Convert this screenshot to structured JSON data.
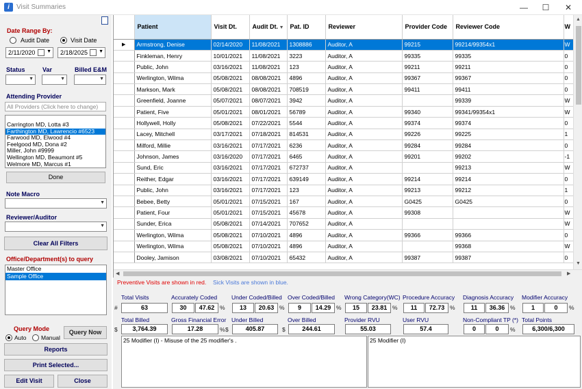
{
  "window": {
    "title": "Visit Summaries",
    "minimize": "—",
    "maximize": "☐",
    "close": "✕"
  },
  "filters": {
    "date_range_label": "Date Range By:",
    "audit_date": "Audit Date",
    "visit_date": "Visit Date",
    "date_from": "2/11/2020",
    "date_to": "2/18/2025",
    "status_label": "Status",
    "var_label": "Var",
    "billed_em_label": "Billed E&M",
    "attending_label": "Attending Provider",
    "attending_placeholder": "All Providers (Click here to change)",
    "providers": [
      "Carrington MD, Lotta #3",
      "Farthington MD, Lawrencio #6523",
      "Farwood MD, Elwood #4",
      "Feelgood MD, Dona #2",
      "Miller, John #9999",
      "Wellington MD, Beaumont #5",
      "Welmore MD, Marcus #1"
    ],
    "done": "Done",
    "note_macro_label": "Note Macro",
    "reviewer_label": "Reviewer/Auditor",
    "clear_filters": "Clear All Filters",
    "office_label": "Office/Department(s) to query",
    "offices": [
      "Master Office",
      "Sample Office"
    ],
    "query_mode_label": "Query Mode",
    "auto": "Auto",
    "manual": "Manual",
    "query_now": "Query Now",
    "reports": "Reports",
    "print_selected": "Print Selected...",
    "edit_visit": "Edit Visit",
    "close": "Close"
  },
  "grid": {
    "columns": [
      "Patient",
      "Visit Dt.",
      "Audit Dt.",
      "Pat. ID",
      "Reviewer",
      "Provider Code",
      "Reviewer Code",
      "W"
    ],
    "rows": [
      [
        "Armstrong, Denise",
        "02/14/2020",
        "11/08/2021",
        "1308886",
        "Auditor, A",
        "99215",
        "99214/99354x1",
        "W"
      ],
      [
        "Finkleman, Henry",
        "10/01/2021",
        "11/08/2021",
        "3223",
        "Auditor, A",
        "99335",
        "99335",
        "0"
      ],
      [
        "Public, John",
        "03/16/2021",
        "11/08/2021",
        "123",
        "Auditor, A",
        "99211",
        "99211",
        "0"
      ],
      [
        "Werlington, Wilma",
        "05/08/2021",
        "08/08/2021",
        "4896",
        "Auditor, A",
        "99367",
        "99367",
        "0"
      ],
      [
        "Markson, Mark",
        "05/08/2021",
        "08/08/2021",
        "708519",
        "Auditor, A",
        "99411",
        "99411",
        "0"
      ],
      [
        "Greenfield, Joanne",
        "05/07/2021",
        "08/07/2021",
        "3942",
        "Auditor, A",
        "",
        "99339",
        "W"
      ],
      [
        "Patient, Five",
        "05/01/2021",
        "08/01/2021",
        "56789",
        "Auditor, A",
        "99340",
        "99341/99354x1",
        "W"
      ],
      [
        "Hollywell, Holly",
        "05/08/2021",
        "07/22/2021",
        "5544",
        "Auditor, A",
        "99374",
        "99374",
        "0"
      ],
      [
        "Lacey, Mitchell",
        "03/17/2021",
        "07/18/2021",
        "814531",
        "Auditor, A",
        "99226",
        "99225",
        "1"
      ],
      [
        "Milford, Millie",
        "03/16/2021",
        "07/17/2021",
        "6236",
        "Auditor, A",
        "99284",
        "99284",
        "0"
      ],
      [
        "Johnson, James",
        "03/16/2020",
        "07/17/2021",
        "6465",
        "Auditor, A",
        "99201",
        "99202",
        "-1"
      ],
      [
        "Sund, Eric",
        "03/16/2021",
        "07/17/2021",
        "672737",
        "Auditor, A",
        "",
        "99213",
        "W"
      ],
      [
        "Reither, Edgar",
        "03/16/2021",
        "07/17/2021",
        "639149",
        "Auditor, A",
        "99214",
        "99214",
        "0"
      ],
      [
        "Public, John",
        "03/16/2021",
        "07/17/2021",
        "123",
        "Auditor, A",
        "99213",
        "99212",
        "1"
      ],
      [
        "Bebee, Betty",
        "05/01/2021",
        "07/15/2021",
        "167",
        "Auditor, A",
        "G0425",
        "G0425",
        "0"
      ],
      [
        "Patient, Four",
        "05/01/2021",
        "07/15/2021",
        "45678",
        "Auditor, A",
        "99308",
        "",
        "W"
      ],
      [
        "Sunder, Erica",
        "05/08/2021",
        "07/14/2021",
        "707652",
        "Auditor, A",
        "",
        "",
        "W"
      ],
      [
        "Werlington, Wilma",
        "05/08/2021",
        "07/10/2021",
        "4896",
        "Auditor, A",
        "99366",
        "99366",
        "0"
      ],
      [
        "Werlington, Wilma",
        "05/08/2021",
        "07/10/2021",
        "4896",
        "Auditor, A",
        "",
        "99368",
        "W"
      ],
      [
        "Dooley, Jamison",
        "03/08/2021",
        "07/10/2021",
        "65432",
        "Auditor, A",
        "99387",
        "99387",
        "0"
      ]
    ]
  },
  "legend": {
    "preventive": "Preventive Visits are shown in red.",
    "sick": "Sick Visits are shown in blue."
  },
  "stats": {
    "total_visits": {
      "label": "Total Visits",
      "value": "63"
    },
    "accurately_coded": {
      "label": "Accurately Coded",
      "count": "30",
      "pct": "47.62"
    },
    "under_coded": {
      "label": "Under Coded/Billed",
      "count": "13",
      "pct": "20.63"
    },
    "over_coded": {
      "label": "Over Coded/Billed",
      "count": "9",
      "pct": "14.29"
    },
    "wrong_category": {
      "label": "Wrong Category(WC)",
      "count": "15",
      "pct": "23.81"
    },
    "procedure_accuracy": {
      "label": "Procedure Accuracy",
      "count": "11",
      "pct": "72.73"
    },
    "diagnosis_accuracy": {
      "label": "Diagnosis Accuracy",
      "count": "11",
      "pct": "36.36"
    },
    "modifier_accuracy": {
      "label": "Modifier Accuracy",
      "count": "1",
      "pct": "0"
    },
    "total_billed": {
      "label": "Total Billed",
      "value": "3,764.39"
    },
    "gross_error": {
      "label": "Gross Financial Error",
      "value": "17.28"
    },
    "under_billed": {
      "label": "Under Billed",
      "value": "405.87"
    },
    "over_billed": {
      "label": "Over Billed",
      "value": "244.61"
    },
    "provider_rvu": {
      "label": "Provider RVU",
      "value": "55.03"
    },
    "user_rvu": {
      "label": "User RVU",
      "value": "57.4"
    },
    "non_compliant": {
      "label": "Non-Compliant TP (*)",
      "count": "0",
      "pct": "0"
    },
    "total_points": {
      "label": "Total Points",
      "value": "6,300/6,300"
    }
  },
  "memos": {
    "left": "25 Modifier (I) - Misuse of the 25 modifier's .",
    "right": "25 Modifier (I)"
  },
  "colors": {
    "selection": "#0078d7",
    "header_selected": "#cce4f7",
    "label_blue": "#00006e",
    "preventive_red": "#e00000",
    "sick_blue": "#4a78d8"
  }
}
